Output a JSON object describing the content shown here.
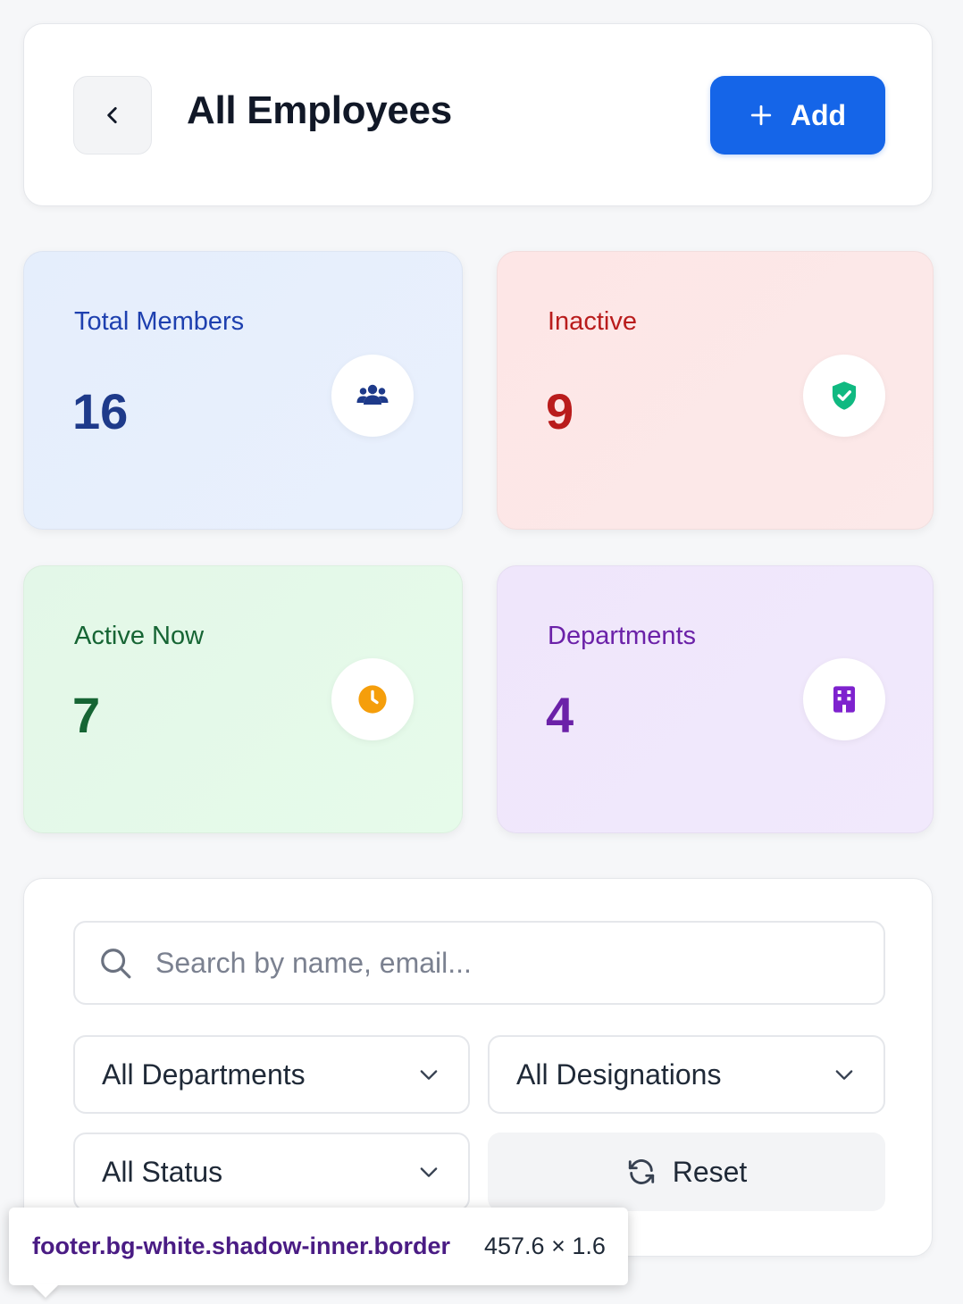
{
  "header": {
    "title": "All Employees",
    "add_label": "Add",
    "back_icon": "chevron-left-icon",
    "add_icon": "plus-icon"
  },
  "stats": {
    "total": {
      "label": "Total Members",
      "value": "16",
      "icon": "users-icon",
      "color": "#1e3a8a"
    },
    "inactive": {
      "label": "Inactive",
      "value": "9",
      "icon": "shield-check-icon",
      "color": "#b91c1c"
    },
    "active": {
      "label": "Active Now",
      "value": "7",
      "icon": "clock-icon",
      "color": "#166534"
    },
    "departments": {
      "label": "Departments",
      "value": "4",
      "icon": "building-icon",
      "color": "#6b21a8"
    }
  },
  "filters": {
    "search_placeholder": "Search by name, email...",
    "department_select": "All Departments",
    "designation_select": "All Designations",
    "status_select": "All Status",
    "reset_label": "Reset"
  },
  "devtools_tooltip": {
    "selector": "footer.bg-white.shadow-inner.border",
    "dimensions": "457.6 × 1.6"
  },
  "colors": {
    "accent": "#1565e8",
    "shield_green": "#10b981",
    "clock_orange": "#f59e0b",
    "building_purple": "#7e22ce",
    "users_blue": "#1e3a8a"
  }
}
